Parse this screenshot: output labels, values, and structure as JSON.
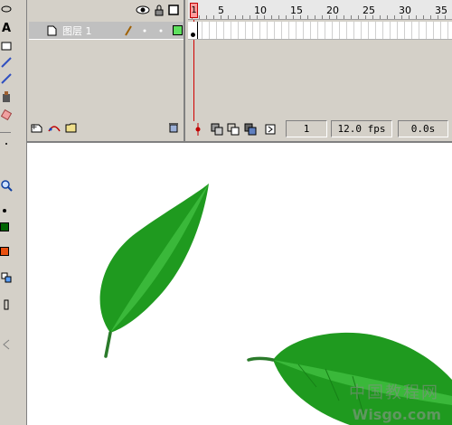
{
  "tools": {
    "items": [
      "text-tool",
      "rectangle-tool",
      "pencil-tool",
      "ink-bottle-tool",
      "eraser-tool",
      "zoom-tool",
      "stroke-color",
      "fill-color",
      "swap-colors"
    ],
    "text_tool_glyph": "A",
    "stroke_color": "#006400",
    "fill_color": "#e85010"
  },
  "timeline": {
    "ruler_numbers": [
      "1",
      "5",
      "10",
      "15",
      "20",
      "25",
      "30",
      "35"
    ],
    "playhead_label": "1",
    "layer": {
      "name": "图层 1"
    },
    "footer": {
      "current_frame": "1",
      "frame_rate": "12.0 fps",
      "elapsed_time": "0.0s"
    }
  },
  "stage": {
    "leaf_color_dark": "#1a8a1a",
    "leaf_color_light": "#33b533",
    "stem_color": "#2a7a2a",
    "watermark_text_zh": "中国教程网",
    "watermark_text_en": "Wisgo.com"
  }
}
